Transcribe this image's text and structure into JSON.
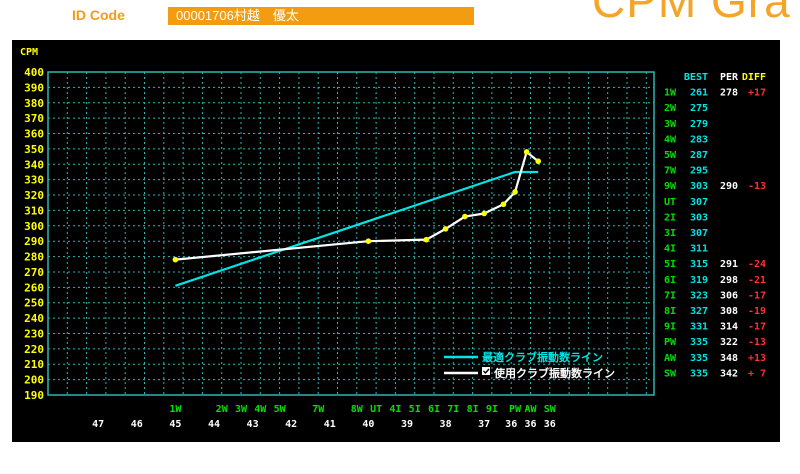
{
  "header": {
    "id_label": "ID Code",
    "id_value": "00001706村越　優太",
    "title": "CPM Gra"
  },
  "colors": {
    "accent": "#f39c12",
    "panel_bg": "#000000",
    "grid": "#2bb7b3",
    "yellow": "#ffff00",
    "cyan": "#00e5e5",
    "green": "#00e000",
    "red": "#ff3030",
    "white": "#ffffff"
  },
  "chart_data": {
    "type": "line",
    "ylabel": "CPM",
    "ylim": [
      190,
      400
    ],
    "ytick_step": 10,
    "grid": true,
    "legend": [
      "最適クラブ振動数ライン",
      "使用クラブ振動数ライン"
    ],
    "legend_checked": [
      false,
      true
    ],
    "x_club_labels": [
      "1W",
      "2W",
      "3W",
      "4W",
      "5W",
      "7W",
      "8W",
      "UT",
      "4I",
      "5I",
      "6I",
      "7I",
      "8I",
      "9I",
      "PW",
      "AW",
      "SW"
    ],
    "x_bottom_numbers": [
      "47",
      "46",
      "45",
      "44",
      "43",
      "42",
      "41",
      "40",
      "39",
      "38",
      "37",
      "36",
      "36",
      "36"
    ],
    "series": [
      {
        "name": "最適クラブ振動数ライン",
        "x": [
          45.0,
          36.2,
          35.6
        ],
        "y": [
          261,
          335,
          335
        ]
      },
      {
        "name": "使用クラブ振動数ライン",
        "x": [
          45.0,
          40.0,
          38.5,
          38.0,
          37.5,
          37.0,
          36.5,
          36.2,
          35.9,
          35.6
        ],
        "y": [
          278,
          290,
          291,
          298,
          306,
          308,
          314,
          322,
          348,
          342
        ]
      }
    ],
    "table": {
      "headers": [
        "BEST",
        "PER",
        "DIFF"
      ],
      "rows": [
        {
          "club": "1W",
          "best": "261",
          "per": "278",
          "diff": "+17"
        },
        {
          "club": "2W",
          "best": "275",
          "per": "",
          "diff": ""
        },
        {
          "club": "3W",
          "best": "279",
          "per": "",
          "diff": ""
        },
        {
          "club": "4W",
          "best": "283",
          "per": "",
          "diff": ""
        },
        {
          "club": "5W",
          "best": "287",
          "per": "",
          "diff": ""
        },
        {
          "club": "7W",
          "best": "295",
          "per": "",
          "diff": ""
        },
        {
          "club": "9W",
          "best": "303",
          "per": "290",
          "diff": "-13"
        },
        {
          "club": "UT",
          "best": "307",
          "per": "",
          "diff": ""
        },
        {
          "club": "2I",
          "best": "303",
          "per": "",
          "diff": ""
        },
        {
          "club": "3I",
          "best": "307",
          "per": "",
          "diff": ""
        },
        {
          "club": "4I",
          "best": "311",
          "per": "",
          "diff": ""
        },
        {
          "club": "5I",
          "best": "315",
          "per": "291",
          "diff": "-24"
        },
        {
          "club": "6I",
          "best": "319",
          "per": "298",
          "diff": "-21"
        },
        {
          "club": "7I",
          "best": "323",
          "per": "306",
          "diff": "-17"
        },
        {
          "club": "8I",
          "best": "327",
          "per": "308",
          "diff": "-19"
        },
        {
          "club": "9I",
          "best": "331",
          "per": "314",
          "diff": "-17"
        },
        {
          "club": "PW",
          "best": "335",
          "per": "322",
          "diff": "-13"
        },
        {
          "club": "AW",
          "best": "335",
          "per": "348",
          "diff": "+13"
        },
        {
          "club": "SW",
          "best": "335",
          "per": "342",
          "diff": "+ 7"
        }
      ]
    }
  }
}
